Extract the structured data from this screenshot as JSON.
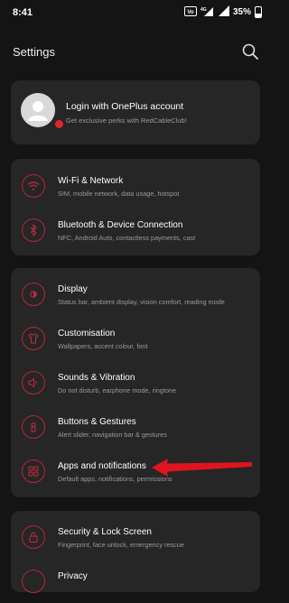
{
  "status_bar": {
    "time": "8:41",
    "volte": "VoLTE",
    "network": "4G",
    "battery": "35%"
  },
  "header": {
    "title": "Settings",
    "search_icon": "search-icon"
  },
  "account": {
    "title": "Login with OnePlus account",
    "subtitle": "Get exclusive perks with RedCableClub!"
  },
  "groups": [
    {
      "items": [
        {
          "label": "Wi-Fi & Network",
          "sub": "SIM, mobile network, data usage, hotspot",
          "icon": "wifi-icon"
        },
        {
          "label": "Bluetooth & Device Connection",
          "sub": "NFC, Android Auto, contactless payments, cast",
          "icon": "bluetooth-icon"
        }
      ]
    },
    {
      "items": [
        {
          "label": "Display",
          "sub": "Status bar, ambient display, vision comfort, reading mode",
          "icon": "display-icon"
        },
        {
          "label": "Customisation",
          "sub": "Wallpapers, accent colour, font",
          "icon": "tshirt-icon"
        },
        {
          "label": "Sounds & Vibration",
          "sub": "Do not disturb, earphone mode, ringtone",
          "icon": "speaker-icon"
        },
        {
          "label": "Buttons & Gestures",
          "sub": "Alert slider, navigation bar & gestures",
          "icon": "gesture-icon"
        },
        {
          "label": "Apps and notifications",
          "sub": "Default apps, notifications, permissions",
          "icon": "apps-grid-icon"
        }
      ]
    },
    {
      "items": [
        {
          "label": "Security & Lock Screen",
          "sub": "Fingerprint, face unlock, emergency rescue",
          "icon": "lock-icon"
        },
        {
          "label": "Privacy",
          "sub": "",
          "icon": "privacy-icon"
        }
      ]
    }
  ],
  "colors": {
    "accent": "#c8283f",
    "card": "#262626",
    "background": "#141414",
    "annotation_arrow": "#e0141e"
  }
}
